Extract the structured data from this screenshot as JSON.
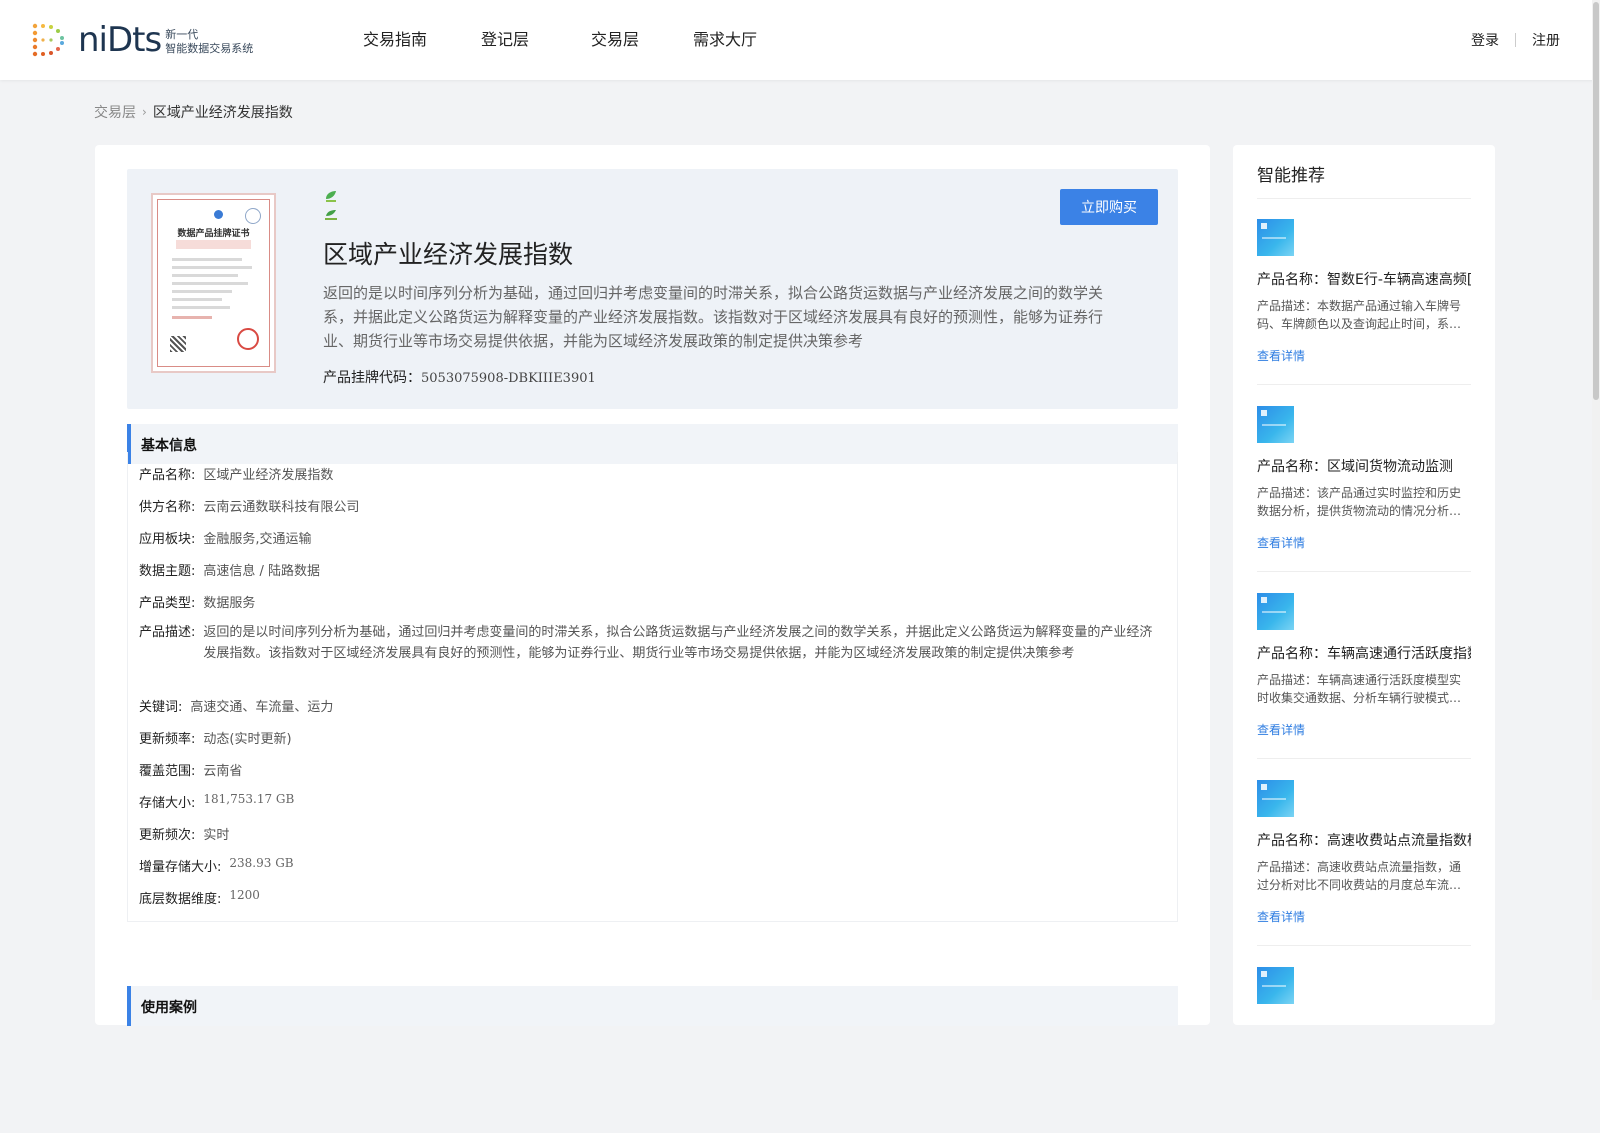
{
  "header": {
    "logo_word": "niDts",
    "logo_sub_line1": "新一代",
    "logo_sub_line2": "智能数据交易系统",
    "nav": [
      "交易指南",
      "登记层",
      "交易层",
      "需求大厅"
    ],
    "login": "登录",
    "register": "注册"
  },
  "breadcrumb": {
    "parent": "交易层",
    "current": "区域产业经济发展指数"
  },
  "product": {
    "title": "区域产业经济发展指数",
    "summary": "返回的是以时间序列分析为基础，通过回归并考虑变量间的时滞关系，拟合公路货运数据与产业经济发展之间的数学关系，并据此定义公路货运为解释变量的产业经济发展指数。该指数对于区域经济发展具有良好的预测性，能够为证券行业、期货行业等市场交易提供依据，并能为区域经济发展政策的制定提供决策参考",
    "buy_label": "立即购买",
    "listing_code_label": "产品挂牌代码：",
    "listing_code": "5053075908-DBKIIIE3901",
    "cert_title": "数据产品挂牌证书"
  },
  "info": {
    "section_title": "基本信息",
    "rows": [
      {
        "label": "产品名称:",
        "value": "区域产业经济发展指数"
      },
      {
        "label": "供方名称:",
        "value": "云南云通数联科技有限公司"
      },
      {
        "label": "应用板块:",
        "value": "金融服务,交通运输"
      },
      {
        "label": "数据主题:",
        "value": "高速信息 / 陆路数据"
      },
      {
        "label": "产品类型:",
        "value": "数据服务"
      },
      {
        "label": "产品描述:",
        "value": "返回的是以时间序列分析为基础，通过回归并考虑变量间的时滞关系，拟合公路货运数据与产业经济发展之间的数学关系，并据此定义公路货运为解释变量的产业经济发展指数。该指数对于区域经济发展具有良好的预测性，能够为证券行业、期货行业等市场交易提供依据，并能为区域经济发展政策的制定提供决策参考"
      },
      {
        "label": "关键词:",
        "value": "高速交通、车流量、运力"
      },
      {
        "label": "更新频率:",
        "value": "动态(实时更新)"
      },
      {
        "label": "覆盖范围:",
        "value": "云南省"
      },
      {
        "label": "存储大小:",
        "value": "181,753.17 GB"
      },
      {
        "label": "更新频次:",
        "value": "实时"
      },
      {
        "label": "增量存储大小:",
        "value": "238.93 GB"
      },
      {
        "label": "底层数据维度:",
        "value": "1200"
      }
    ]
  },
  "next_section_title": "使用案例",
  "sidebar": {
    "title": "智能推荐",
    "items": [
      {
        "name": "产品名称：智数E行-车辆高速高频[",
        "desc": "产品描述：本数据产品通过输入车牌号码、车牌颜色以及查询起止时间，系统将返回该车辆的高速行驶数据",
        "link": "查看详情"
      },
      {
        "name": "产品名称：区域间货物流动监测",
        "desc": "产品描述：该产品通过实时监控和历史数据分析，提供货物流动的情况分析与趋势监测",
        "link": "查看详情"
      },
      {
        "name": "产品名称：车辆高速通行活跃度指数",
        "desc": "产品描述：车辆高速通行活跃度模型实时收集交通数据、分析车辆行驶模式与通行规律",
        "link": "查看详情"
      },
      {
        "name": "产品名称：高速收费站点流量指数模型",
        "desc": "产品描述：高速收费站点流量指数，通过分析对比不同收费站的月度总车流量变化趋势",
        "link": "查看详情"
      }
    ]
  },
  "colors": {
    "accent": "#3b82e6",
    "link": "#2f7de1",
    "page_bg": "#f2f3f5"
  }
}
